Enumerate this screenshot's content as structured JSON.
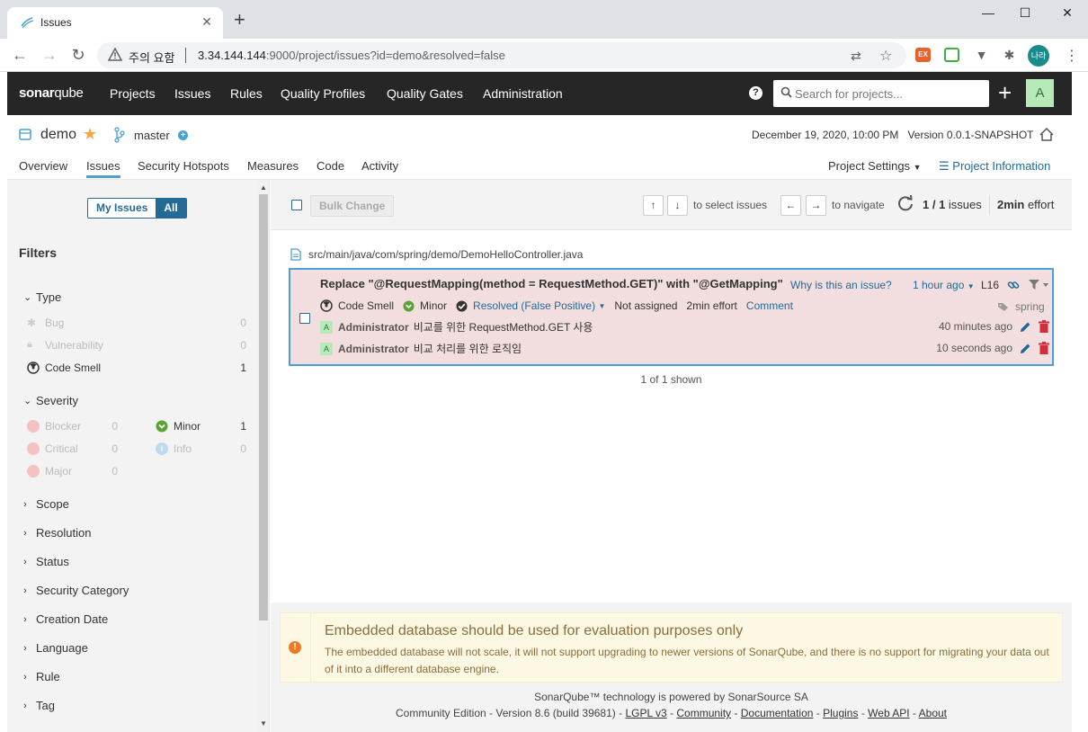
{
  "browser": {
    "tab_title": "Issues",
    "security_warning": "주의 요함",
    "url_host": "3.34.144.144",
    "url_rest": ":9000/project/issues?id=demo&resolved=false",
    "profile_label": "나라",
    "ext1_label": "EX"
  },
  "nav": {
    "logo_a": "sonar",
    "logo_b": "qube",
    "items": [
      "Projects",
      "Issues",
      "Rules",
      "Quality Profiles",
      "Quality Gates",
      "Administration"
    ],
    "search_placeholder": "Search for projects...",
    "avatar_letter": "A"
  },
  "project": {
    "name": "demo",
    "branch": "master",
    "date": "December 19, 2020, 10:00 PM",
    "version": "Version 0.0.1-SNAPSHOT",
    "tabs": [
      "Overview",
      "Issues",
      "Security Hotspots",
      "Measures",
      "Code",
      "Activity"
    ],
    "active_tab": "Issues",
    "settings_label": "Project Settings",
    "info_label": "Project Information"
  },
  "sidebar": {
    "toggle_my": "My Issues",
    "toggle_all": "All",
    "filters_title": "Filters",
    "type_label": "Type",
    "types": [
      {
        "label": "Bug",
        "count": "0"
      },
      {
        "label": "Vulnerability",
        "count": "0"
      },
      {
        "label": "Code Smell",
        "count": "1"
      }
    ],
    "severity_label": "Severity",
    "severities": [
      {
        "label": "Blocker",
        "count": "0"
      },
      {
        "label": "Critical",
        "count": "0"
      },
      {
        "label": "Major",
        "count": "0"
      },
      {
        "label": "Minor",
        "count": "1"
      },
      {
        "label": "Info",
        "count": "0"
      }
    ],
    "facets": [
      "Scope",
      "Resolution",
      "Status",
      "Security Category",
      "Creation Date",
      "Language",
      "Rule",
      "Tag"
    ]
  },
  "toolbar": {
    "bulk_change": "Bulk Change",
    "up_key": "↑",
    "down_key": "↓",
    "select_hint": "to select issues",
    "left_key": "←",
    "right_key": "→",
    "navigate_hint": "to navigate",
    "count_bold": "1 / 1",
    "count_suffix": " issues",
    "effort_bold": "2min",
    "effort_suffix": " effort"
  },
  "issue": {
    "file": "src/main/java/com/spring/demo/DemoHelloController.java",
    "title": "Replace \"@RequestMapping(method = RequestMethod.GET)\" with \"@GetMapping\"",
    "why": "Why is this an issue?",
    "time": "1 hour ago",
    "line": "L16",
    "type": "Code Smell",
    "severity": "Minor",
    "resolution": "Resolved (False Positive)",
    "assignee": "Not assigned",
    "effort": "2min effort",
    "comment_link": "Comment",
    "tag": "spring",
    "comments": [
      {
        "avatar": "A",
        "author": "Administrator",
        "text": "비교를 위한 RequestMethod.GET 사용",
        "time": "40 minutes ago"
      },
      {
        "avatar": "A",
        "author": "Administrator",
        "text": "비교 처리를 위한 로직임",
        "time": "10 seconds ago"
      }
    ],
    "shown": "1 of 1 shown"
  },
  "alert": {
    "title": "Embedded database should be used for evaluation purposes only",
    "text": "The embedded database will not scale, it will not support upgrading to newer versions of SonarQube, and there is no support for migrating your data out of it into a different database engine."
  },
  "footer": {
    "line1": "SonarQube™ technology is powered by SonarSource SA",
    "edition": "Community Edition - Version 8.6 (build 39681) - ",
    "links": [
      "LGPL v3",
      "Community",
      "Documentation",
      "Plugins",
      "Web API",
      "About"
    ]
  },
  "colors": {
    "accent": "#236a97",
    "link_blue": "#4b9fd5",
    "nav_bg": "#262626",
    "issue_bg": "#f2dede",
    "alert_bg": "#fcf8e3"
  }
}
